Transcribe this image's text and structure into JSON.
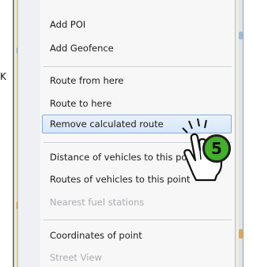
{
  "side_label": "K",
  "menu": {
    "items": [
      {
        "label": "Add POI",
        "state": "normal"
      },
      {
        "label": "Add Geofence",
        "state": "normal"
      },
      {
        "label": "Route from here",
        "state": "normal"
      },
      {
        "label": "Route to here",
        "state": "normal"
      },
      {
        "label": "Remove calculated route",
        "state": "selected"
      },
      {
        "label": "Distance of vehicles to this point",
        "state": "normal"
      },
      {
        "label": "Routes of vehicles to this point",
        "state": "normal"
      },
      {
        "label": "Nearest fuel stations",
        "state": "disabled"
      },
      {
        "label": "Coordinates of point",
        "state": "normal"
      },
      {
        "label": "Street View",
        "state": "disabled"
      }
    ]
  },
  "annotation": {
    "step_number": "5",
    "cursor": "hand-pointer-icon"
  },
  "colors": {
    "highlight": "#d6e6f9",
    "highlight_border": "#86aee0",
    "badge": "#43b02a",
    "disabled_text": "#a9acb1"
  }
}
